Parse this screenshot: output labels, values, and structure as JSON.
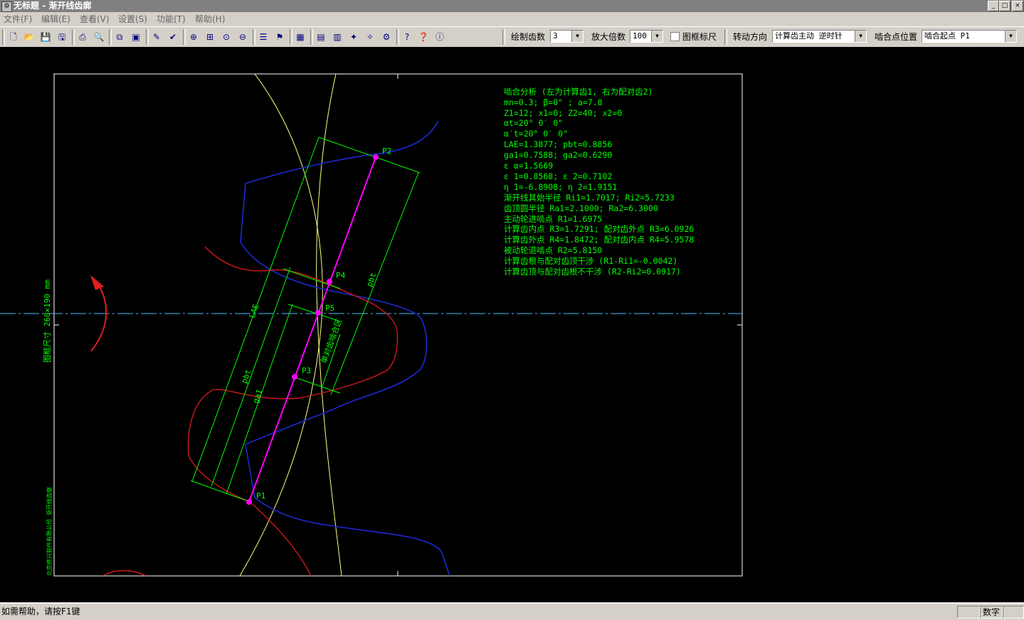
{
  "window": {
    "title": "无标题 - 渐开线齿廓",
    "icon": "app-icon",
    "buttons": {
      "minimize": "_",
      "restore": "□",
      "close": "×"
    }
  },
  "menu": {
    "items": [
      "文件(F)",
      "编辑(E)",
      "查看(V)",
      "设置(S)",
      "功能(T)",
      "帮助(H)"
    ]
  },
  "toolbar": {
    "icons": [
      "new-icon",
      "open-icon",
      "save-icon",
      "save-all-icon",
      "print-icon",
      "print-preview-icon",
      "copy-icon",
      "export-icon",
      "properties-icon",
      "check-icon",
      "zoom-in-icon",
      "zoom-window-icon",
      "zoom-all-icon",
      "zoom-out-icon",
      "layer-icon",
      "settings-icon",
      "table-icon",
      "image-icon",
      "image2-icon",
      "image3-icon",
      "image4-icon",
      "gear-icon",
      "help-pointer-icon",
      "help-icon",
      "about-icon"
    ],
    "draw_teeth_label": "绘制齿数",
    "draw_teeth_value": "3",
    "zoom_label": "放大倍数",
    "zoom_value": "100",
    "frame_ruler_label": "图框标尺",
    "direction_label": "转动方向",
    "direction_value": "计算齿主动 逆时针",
    "mesh_point_label": "啮合点位置",
    "mesh_point_value": "啮合起点 P1"
  },
  "drawing": {
    "frame_size_label": "图框尺寸  260×190 mm",
    "company_label": "北京终兴软件有限公司 渐开线齿廓",
    "points": {
      "p1": "P1",
      "p2": "P2",
      "p3": "P3",
      "p4": "P4",
      "p5": "P5"
    },
    "dimension_labels": {
      "lae": "LAE",
      "pbt_left": "pbt",
      "pbt_right": "pbt",
      "ga1": "ga1",
      "single_mesh": "单对齿啮合区"
    },
    "analysis_lines": [
      "啮合分析 (左为计算齿1, 右为配对齿2)",
      "mn=0.3; β=0\" ; a=7.8",
      "Z1=12; x1=0; Z2=40; x2=0",
      " αt=20° 0′ 0\"",
      " α′t=20° 0′ 0\"",
      "LAE=1.3877; pbt=0.8856",
      "ga1=0.7588; ga2=0.6290",
      " ε α=1.5669",
      " ε 1=0.8568; ε 2=0.7102",
      " η 1=-6.8908; η 2=1.9151",
      "渐开线其始半径 Ri1=1.7017; Ri2=5.7233",
      "齿顶圆半径 Ra1=2.1000; Ra2=6.3000",
      "主动轮进啮点 R1=1.6975",
      "计算齿内点 R3=1.7291; 配对齿外点 R3=6.0926",
      "计算齿外点 R4=1.8472; 配对齿内点 R4=5.9578",
      "被动轮退啮点 R2=5.8150",
      "计算齿根与配对齿顶干涉 (R1-Ri1=-0.0042)",
      "计算齿顶与配对齿根不干涉 (R2-Ri2=0.0917)"
    ]
  },
  "status": {
    "help_text": "如需帮助，请按F1键",
    "mode": "数字"
  },
  "colors": {
    "canvas_bg": "#000000",
    "frame": "#ffffff",
    "text_green": "#00ff00",
    "point_magenta": "#ff00ff",
    "tooth1_red": "#d01818",
    "tooth2_blue": "#1c2ad0",
    "pitch_yellow": "#ffff80",
    "centerline_cyan": "#40c0ff"
  }
}
